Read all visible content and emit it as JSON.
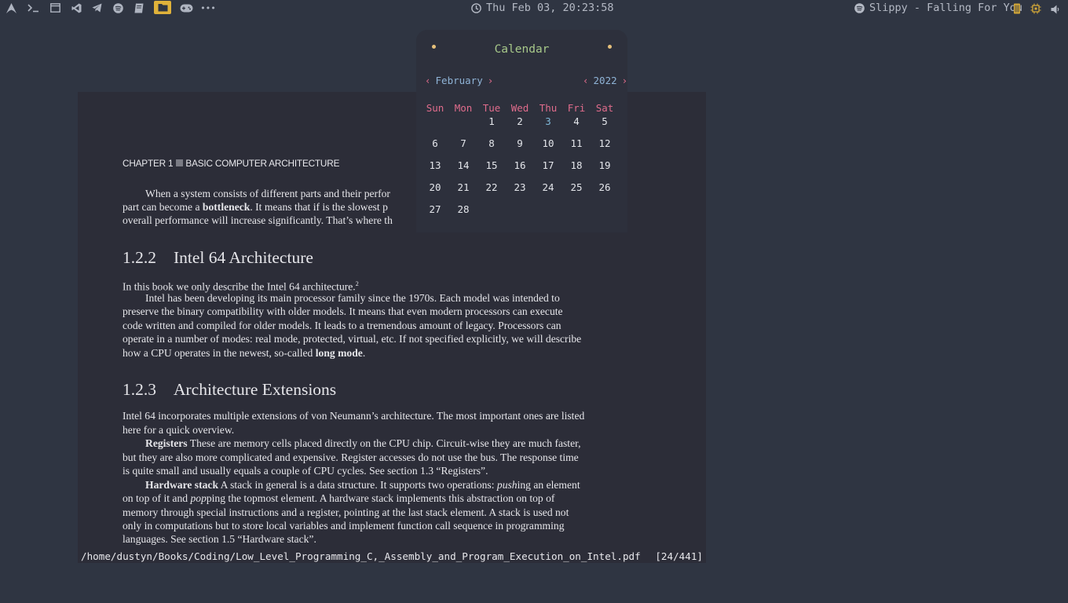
{
  "topbar": {
    "left_icons": [
      "arch-logo-icon",
      "terminal-icon",
      "window-icon",
      "vscode-icon",
      "telegram-icon",
      "spotify-icon",
      "book-icon",
      "folder-icon",
      "gamepad-icon",
      "more-icon"
    ],
    "clock": "Thu Feb 03, 20:23:58",
    "now_playing": "Slippy - Falling For You",
    "accent": "#e0b23a"
  },
  "calendar": {
    "title": "Calendar",
    "month": "February",
    "year": "2022",
    "weekdays": [
      "Sun",
      "Mon",
      "Tue",
      "Wed",
      "Thu",
      "Fri",
      "Sat"
    ],
    "first_weekday_index": 2,
    "days_in_month": 28,
    "today": 3
  },
  "pdf": {
    "chapter": "CHAPTER 1",
    "chapter_title": "BASIC COMPUTER ARCHITECTURE",
    "p1_l1": "When a system consists of different parts and their perfor",
    "p1_l2a": "part can become a ",
    "p1_l2b": "bottleneck",
    "p1_l2c": ". It means that if is the slowest p",
    "p1_l3": "overall performance will increase significantly. That’s where th",
    "s122_num": "1.2.2",
    "s122_title": "Intel 64 Architecture",
    "p2": "In this book we only describe the Intel 64 architecture.",
    "p2_sup": "2",
    "p3_l1": "Intel has been developing its main processor family since the 1970s. Each model was intended to",
    "p3_l2": "preserve the binary compatibility with older models. It means that even modern processors can execute",
    "p3_l3": "code written and compiled for older models. It leads to a tremendous amount of legacy. Processors can",
    "p3_l4": "operate in a number of modes: real mode, protected, virtual, etc. If not specified explicitly, we will describe",
    "p3_l5a": "how a CPU operates in the newest, so-called ",
    "p3_l5b": "long mode",
    "p3_l5c": ".",
    "s123_num": "1.2.3",
    "s123_title": "Architecture Extensions",
    "p4_l1": "Intel 64 incorporates multiple extensions of von Neumann’s architecture. The most important ones are listed",
    "p4_l2": "here for a quick overview.",
    "p5_term": "Registers",
    "p5_l1": " These are memory cells placed directly on the CPU chip. Circuit-wise they are much faster,",
    "p5_l2": "but they are also more complicated and expensive. Register accesses do not use the bus. The response time",
    "p5_l3": "is quite small and usually equals a couple of CPU cycles. See section 1.3 “Registers”.",
    "p6_term": "Hardware stack",
    "p6_l1a": " A stack in general is a data structure. It supports two operations: ",
    "p6_l1b": "push",
    "p6_l1c": "ing an element",
    "p6_l2a": "on top of it and ",
    "p6_l2b": "pop",
    "p6_l2c": "ping the topmost element. A hardware stack implements this abstraction on top of",
    "p6_l3": "memory through special instructions and a register, pointing at the last stack element. A stack is used not",
    "p6_l4": "only in computations but to store local variables and implement function call sequence in programming",
    "p6_l5": "languages. See section 1.5 “Hardware stack”."
  },
  "statusbar": {
    "path": "/home/dustyn/Books/Coding/Low_Level_Programming_C,_Assembly_and_Program_Execution_on_Intel.pdf",
    "page": "[24/441]"
  }
}
